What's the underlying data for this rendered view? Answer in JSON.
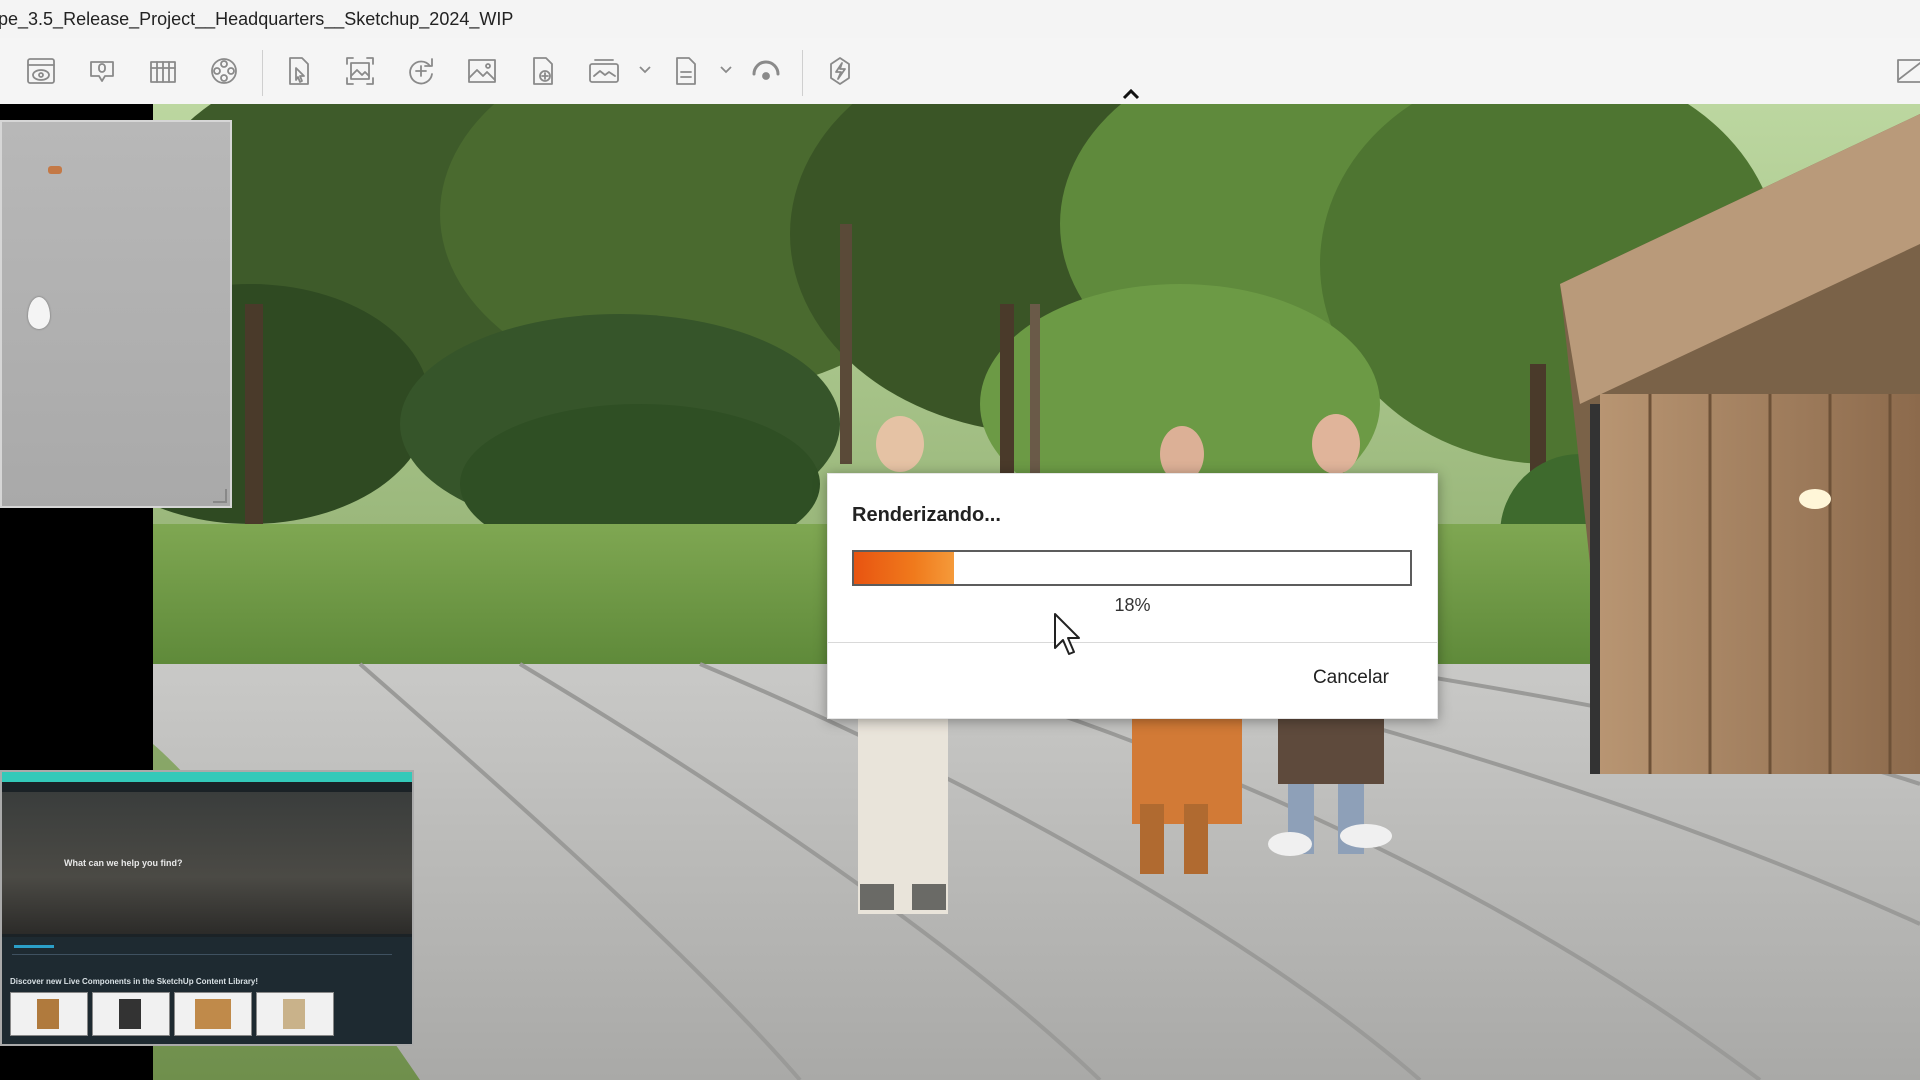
{
  "window": {
    "title": "pe_3.5_Release_Project__Headquarters__Sketchup_2024_WIP"
  },
  "toolbar": {
    "buttons": [
      "visibility-icon",
      "mic-icon",
      "library-icon",
      "film-reel-icon",
      "select-file-icon",
      "frame-icon",
      "add-animation-icon",
      "image-icon",
      "export-file-icon",
      "panorama-360-icon",
      "exe-file-icon",
      "sync-icon",
      "lightning-icon"
    ]
  },
  "dialog": {
    "title": "Renderizando...",
    "progress_percent": 18,
    "progress_label": "18%",
    "cancel_label": "Cancelar"
  },
  "pip": {
    "heading": "What can we help you find?",
    "subheading": "Discover new Live Components in the SketchUp Content Library!"
  },
  "colors": {
    "progress_accent": "#e85411",
    "pip_accent": "#33c9b9"
  }
}
